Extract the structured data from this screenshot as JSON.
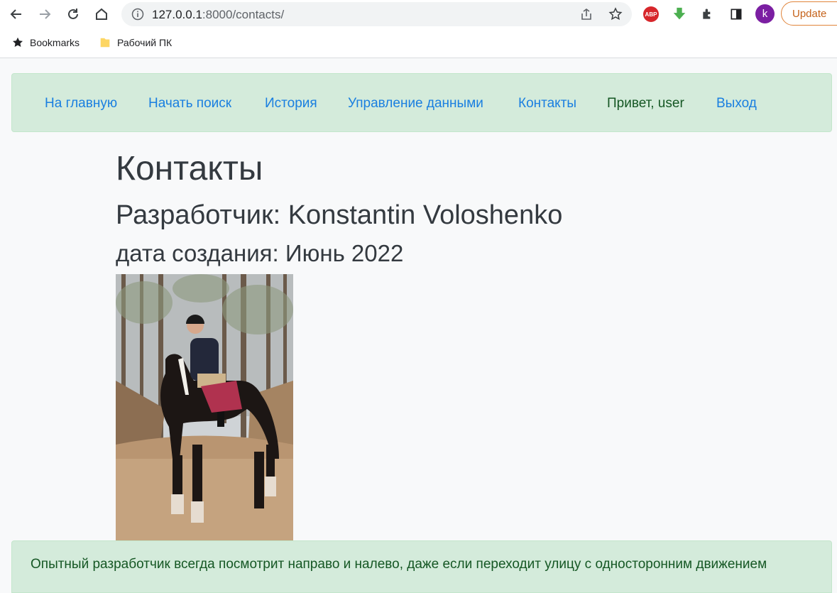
{
  "browser": {
    "url_host": "127.0.0.1",
    "url_rest": ":8000/contacts/",
    "avatar_letter": "k",
    "update_label": "Update",
    "abp_label": "ABP",
    "bookmarks": [
      {
        "label": "Bookmarks",
        "icon": "star-icon"
      },
      {
        "label": "Рабочий ПК",
        "icon": "folder-icon"
      }
    ]
  },
  "nav": {
    "items": [
      {
        "label": "На главную"
      },
      {
        "label": "Начать поиск"
      },
      {
        "label": "История"
      },
      {
        "label": "Управление данными"
      },
      {
        "label": "Контакты"
      },
      {
        "label": "Привет, user"
      },
      {
        "label": "Выход"
      }
    ]
  },
  "content": {
    "title": "Контакты",
    "developer": "Разработчик: Konstantin Voloshenko",
    "created": "дата создания: Июнь 2022"
  },
  "footer": {
    "quote": "Опытный разработчик всегда посмотрит направо и налево, даже если переходит улицу с односторонним движением"
  },
  "colors": {
    "nav_bg": "#d4ebdb",
    "link": "#1a7fe0",
    "text_green": "#155724",
    "heading": "#343a40"
  }
}
